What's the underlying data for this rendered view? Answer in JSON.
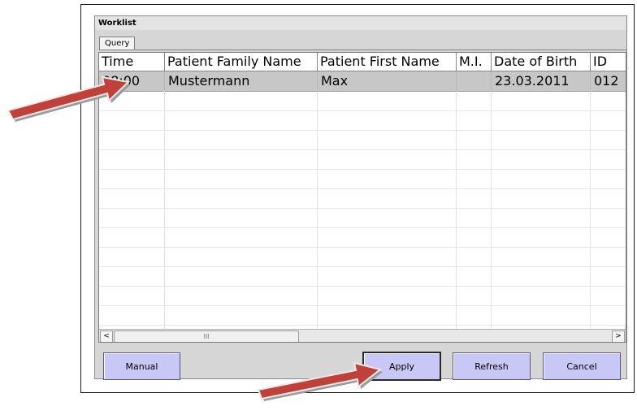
{
  "window": {
    "title": "Worklist"
  },
  "tabs": [
    {
      "label": "Query"
    }
  ],
  "table": {
    "columns": [
      "Time",
      "Patient Family Name",
      "Patient First Name",
      "M.I.",
      "Date of Birth",
      "ID"
    ],
    "rows": [
      {
        "time": "08:00",
        "family_name": "Mustermann",
        "first_name": "Max",
        "mi": "",
        "dob": "23.03.2011",
        "id": "012"
      }
    ]
  },
  "scrollbar": {
    "left_arrow": "<",
    "right_arrow": ">",
    "thumb_grip": "III"
  },
  "buttons": {
    "manual": "Manual",
    "apply": "Apply",
    "refresh": "Refresh",
    "cancel": "Cancel"
  },
  "colors": {
    "button_fill": "#c9c7f5",
    "arrow": "#c0413a",
    "selection": "#c7c7c7"
  }
}
